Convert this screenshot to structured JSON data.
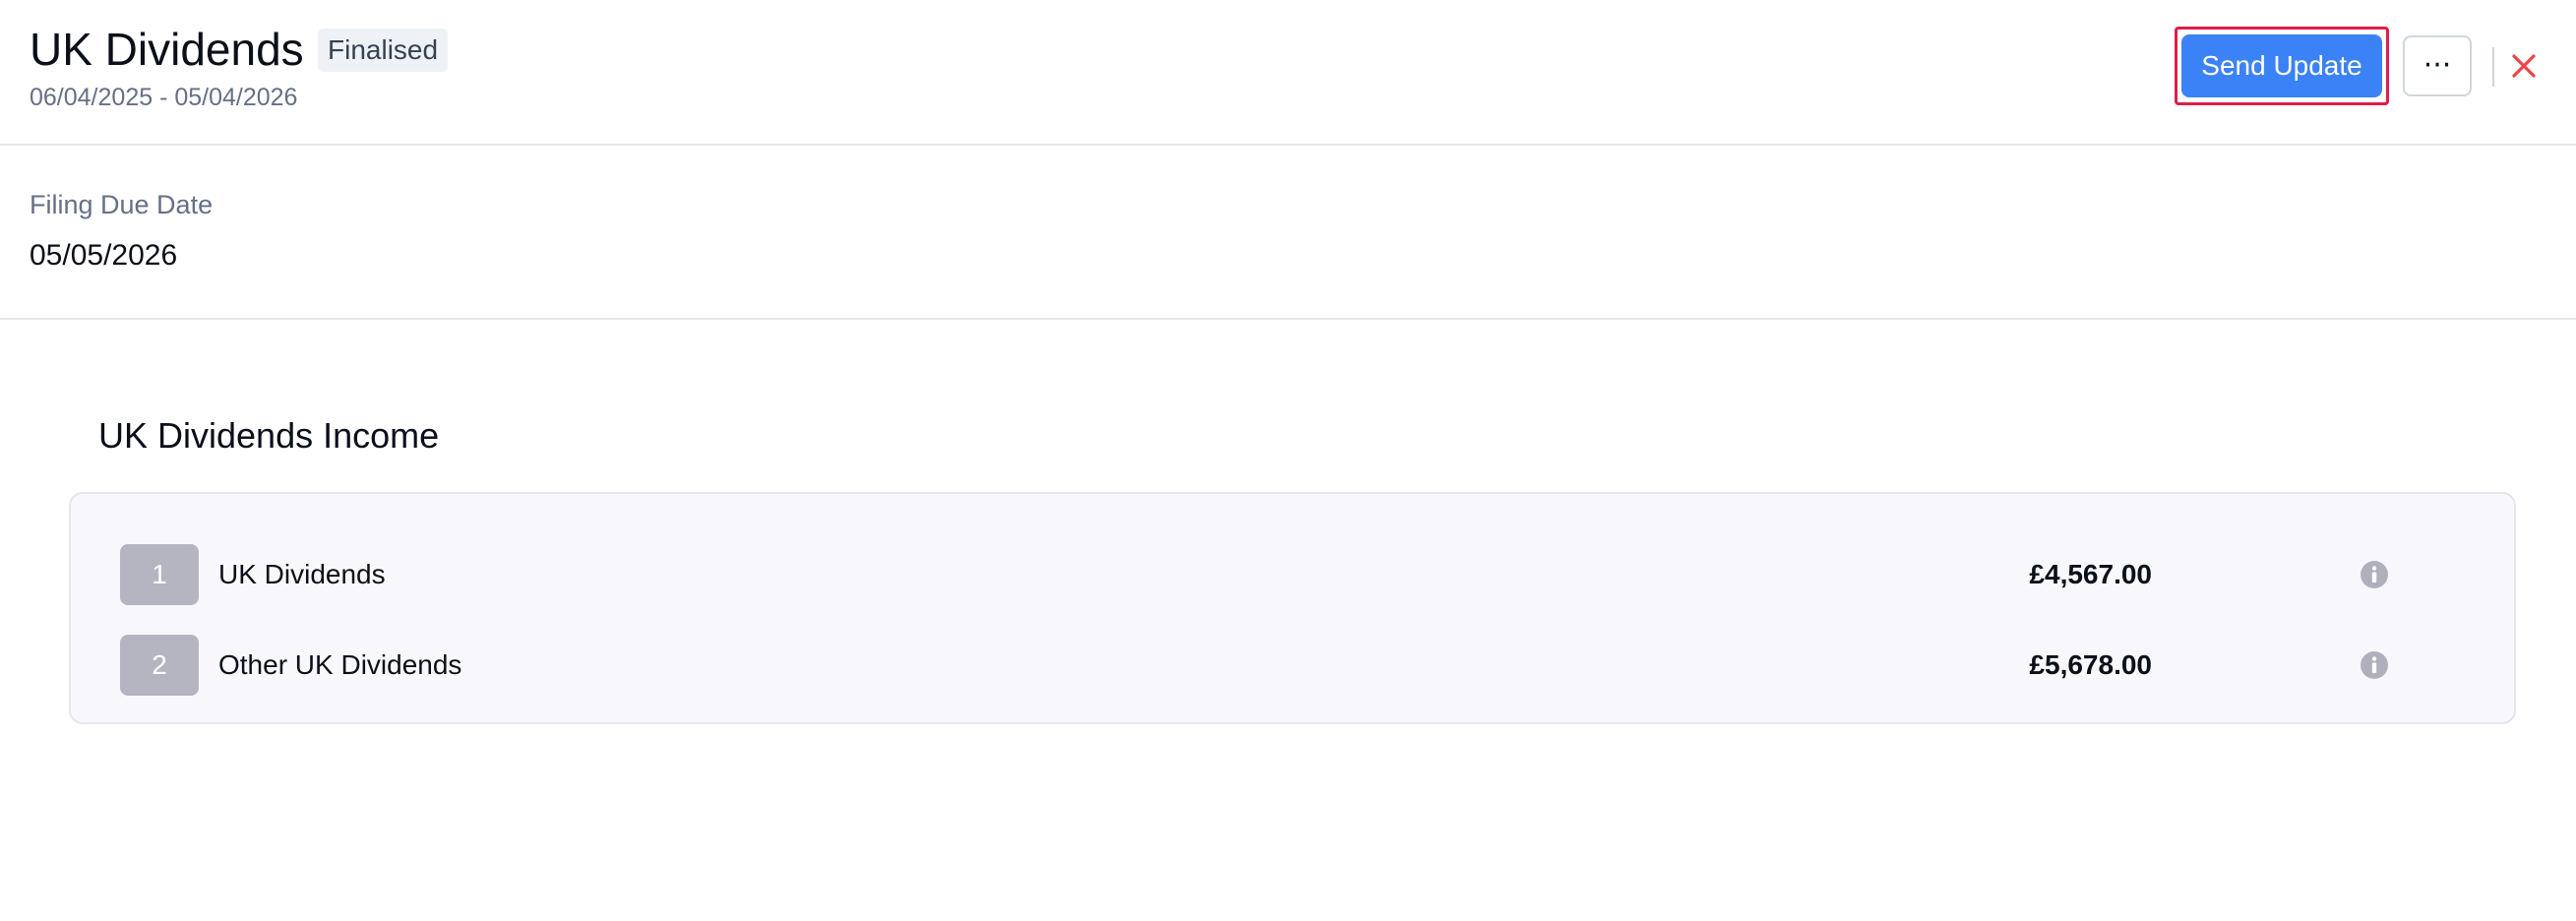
{
  "header": {
    "title": "UK Dividends",
    "status_badge": "Finalised",
    "date_range": "06/04/2025 - 05/04/2026",
    "send_update_label": "Send Update",
    "more_label": "···"
  },
  "filing": {
    "label": "Filing Due Date",
    "value": "05/05/2026"
  },
  "income": {
    "title": "UK Dividends Income",
    "rows": [
      {
        "number": "1",
        "label": "UK Dividends",
        "amount": "£4,567.00"
      },
      {
        "number": "2",
        "label": "Other UK Dividends",
        "amount": "£5,678.00"
      }
    ]
  },
  "icons": {
    "close": "close-icon",
    "info": "info-icon",
    "more": "more-horizontal-icon"
  },
  "colors": {
    "primary": "#3b82f6",
    "close": "#ef4444",
    "highlight": "#e11d48",
    "badge_bg": "#eef2f7",
    "number_bg": "#b5b5c2"
  }
}
